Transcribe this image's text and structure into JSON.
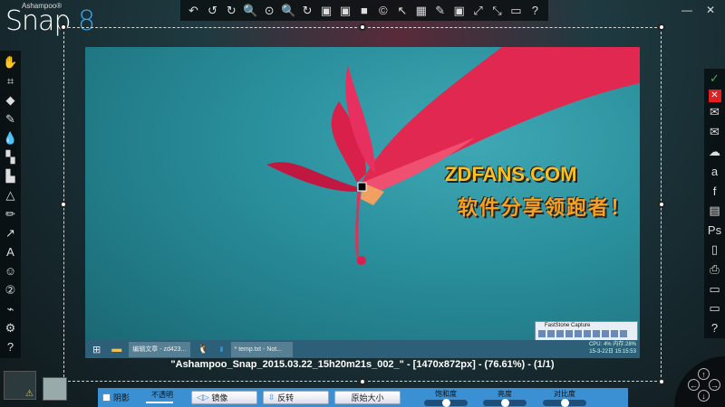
{
  "app": {
    "brand_small": "Ashampoo®",
    "name": "Snap",
    "version": "8"
  },
  "window_controls": {
    "minimize": "—",
    "close": "✕"
  },
  "top_toolbar": [
    "undo-all",
    "undo",
    "redo",
    "zoom-out",
    "zoom-100",
    "zoom-in",
    "rotate",
    "image-adjust",
    "image-adjust-2",
    "gradient",
    "copyright",
    "pointer",
    "stamp-timer",
    "magic-wand",
    "crop-fit",
    "expand",
    "shrink",
    "rectangle",
    "help"
  ],
  "top_glyphs": [
    "↶",
    "↺",
    "↻",
    "🔍",
    "⊙",
    "🔍",
    "↻",
    "▣",
    "▣",
    "■",
    "©",
    "↖",
    "▦",
    "✎",
    "▣",
    "⤢",
    "⤡",
    "▭",
    "?"
  ],
  "left_toolbar": [
    "hand",
    "crop",
    "eraser",
    "marker",
    "drop",
    "blur-region",
    "fill",
    "shapes",
    "pencil",
    "arrow",
    "text",
    "emoji",
    "numbering",
    "highlighter",
    "settings",
    "help"
  ],
  "left_glyphs": [
    "✋",
    "⌗",
    "◆",
    "✎",
    "💧",
    "▚",
    "▙",
    "△",
    "✏",
    "↗",
    "A",
    "☺",
    "②",
    "⌁",
    "⚙",
    "?"
  ],
  "right_toolbar": [
    "confirm",
    "discard",
    "email",
    "email-send",
    "cloud-upload",
    "translate",
    "facebook",
    "save-as",
    "photoshop",
    "clipboard",
    "print",
    "open-folder",
    "save-folder",
    "help"
  ],
  "right_glyphs": [
    "✓",
    "✕",
    "✉",
    "✉",
    "☁",
    "a",
    "f",
    "▤",
    "Ps",
    "▯",
    "⎙",
    "▭",
    "▭",
    "?"
  ],
  "colors": {
    "confirm": "#4caf50",
    "discard": "#e02020",
    "panel": "#3b8fd3"
  },
  "screenshot": {
    "watermark_line1": "ZDFANS.COM",
    "watermark_line2": "软件分享领跑者！",
    "taskbar": {
      "task1": "编辑文章 - zd423...",
      "task2": "* temp.txt - Not...",
      "cpu": "CPU: 4%  内存:28%",
      "datetime": "15-3-22日 15:15:53"
    },
    "faststone_title": "FastStone Capture"
  },
  "caption": "\"Ashampoo_Snap_2015.03.22_15h20m21s_002_\" - [1470x872px] - (76.61%) - (1/1)",
  "bottom_panel": {
    "shadow_label": "阴影",
    "shadow_checked": false,
    "opacity_label": "不透明",
    "opacity_value": 1.0,
    "mirror_label": "镜像",
    "flip_label": "反转",
    "original_size_label": "原始大小",
    "saturation_label": "饱和度",
    "saturation_value": 0.5,
    "brightness_label": "亮度",
    "brightness_value": 0.5,
    "contrast_label": "对比度",
    "contrast_value": 0.5
  },
  "nav": {
    "up": "↑",
    "down": "↓",
    "left": "←",
    "right": "→"
  }
}
